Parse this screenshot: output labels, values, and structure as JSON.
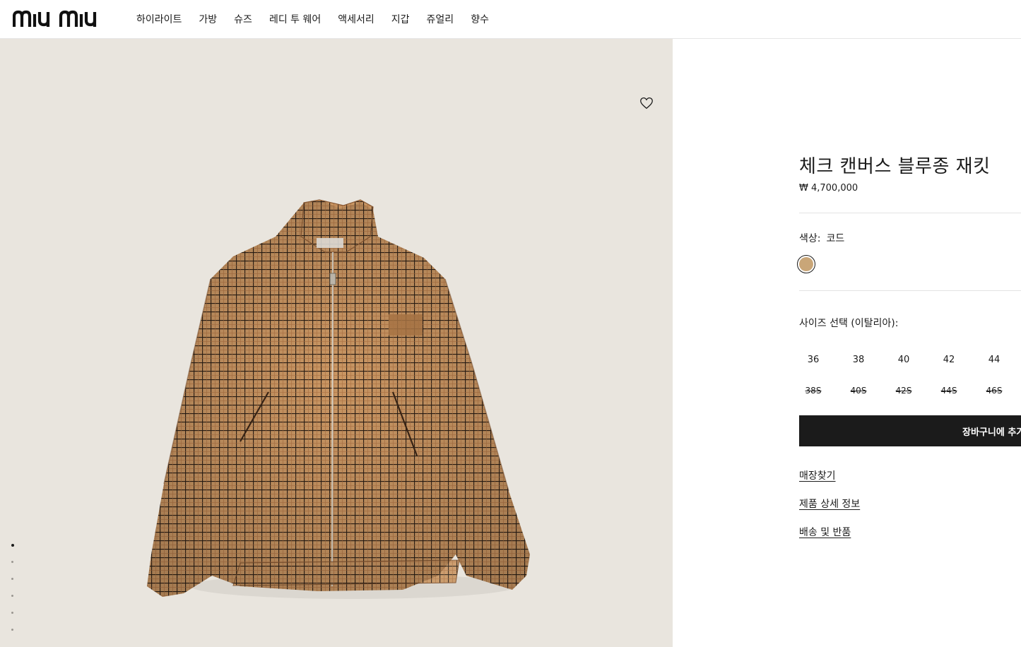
{
  "brand": {
    "logo_text": "miu miu"
  },
  "nav": {
    "items": [
      {
        "label": "하이라이트"
      },
      {
        "label": "가방"
      },
      {
        "label": "슈즈"
      },
      {
        "label": "레디 투 웨어"
      },
      {
        "label": "액세서리"
      },
      {
        "label": "지갑"
      },
      {
        "label": "쥬얼리"
      },
      {
        "label": "향수"
      }
    ]
  },
  "gallery": {
    "wishlist_icon": "heart-outline-icon",
    "background_color": "#e9e5de",
    "image_count": 6,
    "active_index": 0
  },
  "product": {
    "title": "체크 캔버스 블루종 재킷",
    "price": "₩ 4,700,000",
    "color_label": "색상:",
    "color_value": "코드",
    "swatch_color": "#c9a678",
    "size_label": "사이즈 선택 (이탈리아):",
    "sizes_available": [
      "36",
      "38",
      "40",
      "42",
      "44"
    ],
    "sizes_unavailable": [
      "38S",
      "40S",
      "42S",
      "44S",
      "46S"
    ],
    "add_to_cart": "장바구니에 추가",
    "links": {
      "store_finder": "매장찾기",
      "product_details": "제품 상세 정보",
      "shipping_returns": "배송 및 반품"
    }
  }
}
